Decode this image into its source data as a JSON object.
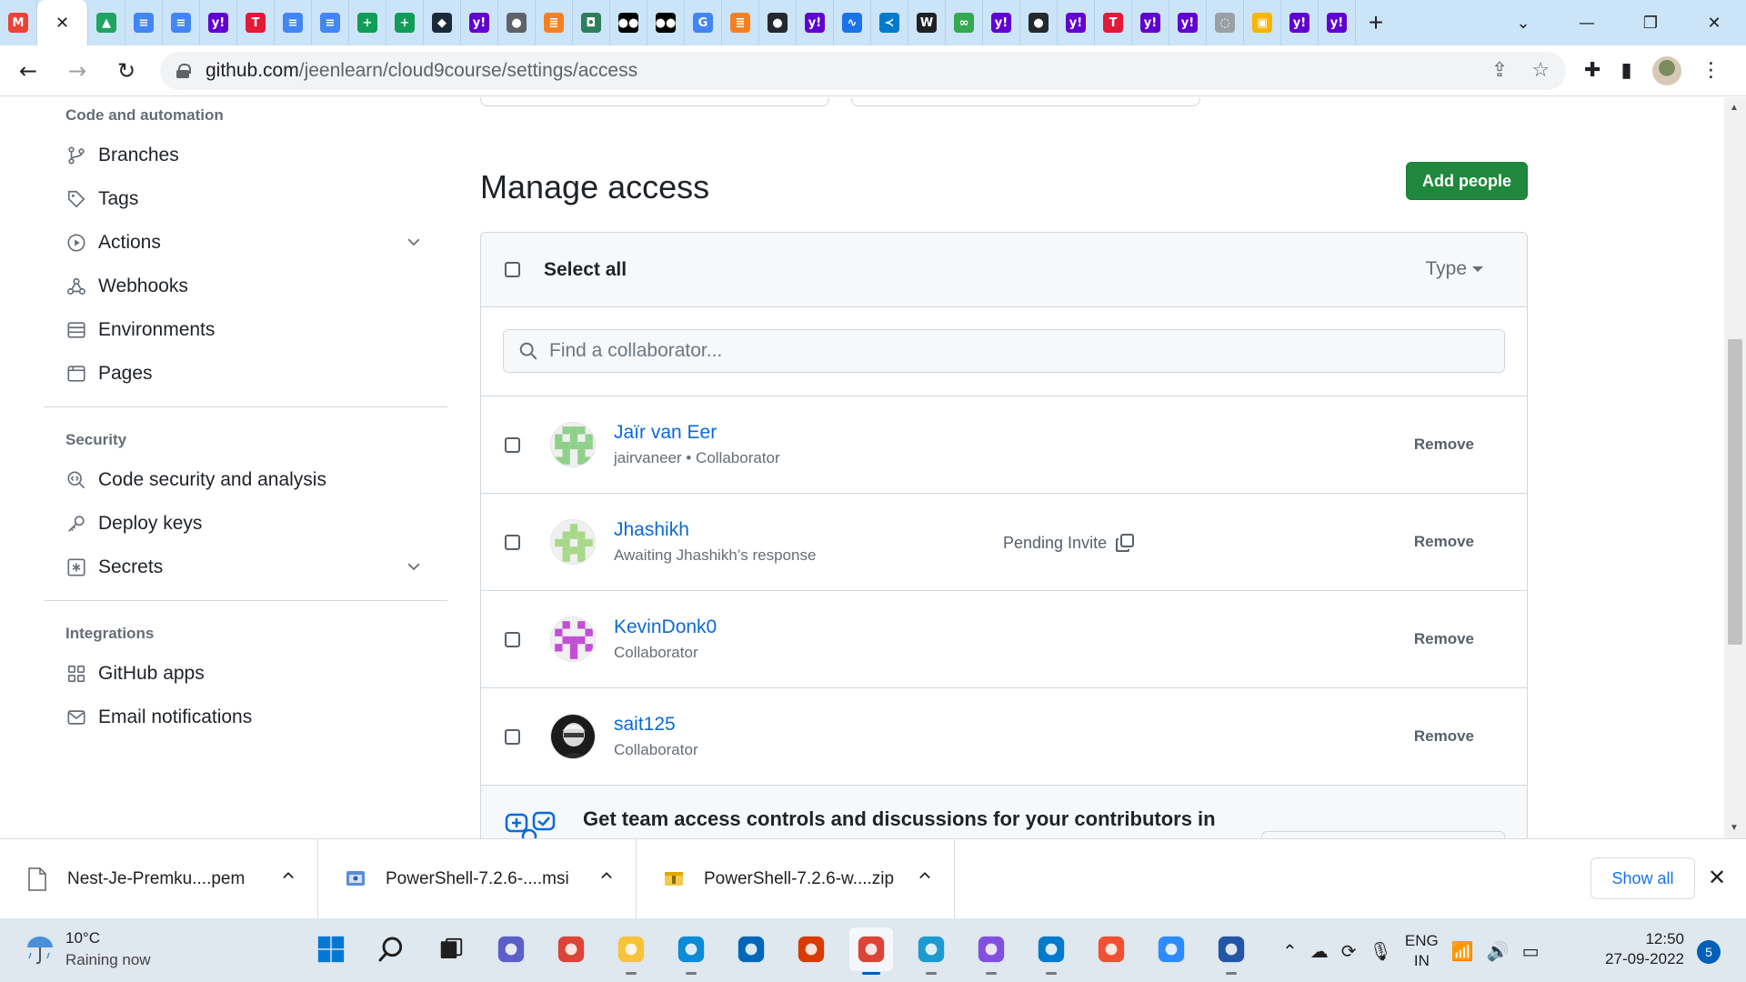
{
  "browser": {
    "tab_favicons": [
      {
        "icon": "gmail-icon",
        "label": "M",
        "color": "#ea4335"
      },
      {
        "icon": "close-tab-icon",
        "label": "✕",
        "color": "#202124"
      },
      {
        "icon": "google-drive-icon",
        "label": "▲",
        "color": "#1fa463"
      },
      {
        "icon": "google-docs-icon",
        "label": "≡",
        "color": "#4285f4"
      },
      {
        "icon": "google-docs-icon",
        "label": "≡",
        "color": "#4285f4"
      },
      {
        "icon": "yahoo-icon",
        "label": "y!",
        "color": "#6001d2"
      },
      {
        "icon": "tesla-icon",
        "label": "T",
        "color": "#e31937"
      },
      {
        "icon": "google-docs-icon",
        "label": "≡",
        "color": "#4285f4"
      },
      {
        "icon": "google-docs-icon",
        "label": "≡",
        "color": "#4285f4"
      },
      {
        "icon": "google-sheets-icon",
        "label": "+",
        "color": "#0f9d58"
      },
      {
        "icon": "google-sheets-icon",
        "label": "+",
        "color": "#0f9d58"
      },
      {
        "icon": "hex-icon",
        "label": "◆",
        "color": "#1b2a3a"
      },
      {
        "icon": "yahoo-icon",
        "label": "y!",
        "color": "#6001d2"
      },
      {
        "icon": "globe-icon",
        "label": "●",
        "color": "#5f6368"
      },
      {
        "icon": "stack-icon",
        "label": "≣",
        "color": "#f48024"
      },
      {
        "icon": "shield-icon",
        "label": "◘",
        "color": "#2e7d5b"
      },
      {
        "icon": "medium-icon",
        "label": "●●",
        "color": "#000000"
      },
      {
        "icon": "medium-icon",
        "label": "●●",
        "color": "#000000"
      },
      {
        "icon": "google-icon",
        "label": "G",
        "color": "#4285f4"
      },
      {
        "icon": "stack-icon",
        "label": "≣",
        "color": "#f48024"
      },
      {
        "icon": "github-icon",
        "label": "●",
        "color": "#24292f"
      },
      {
        "icon": "yahoo-icon",
        "label": "y!",
        "color": "#6001d2"
      },
      {
        "icon": "chart-icon",
        "label": "∿",
        "color": "#1a73e8"
      },
      {
        "icon": "vscode-icon",
        "label": "≺",
        "color": "#007acc"
      },
      {
        "icon": "wikipedia-icon",
        "label": "W",
        "color": "#202124"
      },
      {
        "icon": "infinity-icon",
        "label": "∞",
        "color": "#34a853"
      },
      {
        "icon": "yahoo-icon",
        "label": "y!",
        "color": "#6001d2"
      },
      {
        "icon": "github-icon",
        "label": "●",
        "color": "#24292f"
      },
      {
        "icon": "yahoo-icon",
        "label": "y!",
        "color": "#6001d2"
      },
      {
        "icon": "tesla-icon",
        "label": "T",
        "color": "#e31937"
      },
      {
        "icon": "yahoo-icon",
        "label": "y!",
        "color": "#6001d2"
      },
      {
        "icon": "yahoo-icon",
        "label": "y!",
        "color": "#6001d2"
      },
      {
        "icon": "loading-icon",
        "label": "◌",
        "color": "#9aa0a6"
      },
      {
        "icon": "python-icon",
        "label": "▣",
        "color": "#f7b500"
      },
      {
        "icon": "yahoo-icon",
        "label": "y!",
        "color": "#6001d2"
      },
      {
        "icon": "yahoo-icon",
        "label": "y!",
        "color": "#6001d2"
      }
    ],
    "url_host": "github.com",
    "url_path": "/jeenlearn/cloud9course/settings/access"
  },
  "sidebar": {
    "sections": [
      {
        "heading": "Code and automation",
        "items": [
          {
            "label": "Branches",
            "icon": "branch-icon",
            "expandable": false
          },
          {
            "label": "Tags",
            "icon": "tag-icon",
            "expandable": false
          },
          {
            "label": "Actions",
            "icon": "play-icon",
            "expandable": true
          },
          {
            "label": "Webhooks",
            "icon": "webhook-icon",
            "expandable": false
          },
          {
            "label": "Environments",
            "icon": "server-icon",
            "expandable": false
          },
          {
            "label": "Pages",
            "icon": "browser-icon",
            "expandable": false
          }
        ]
      },
      {
        "heading": "Security",
        "items": [
          {
            "label": "Code security and analysis",
            "icon": "codescan-icon",
            "expandable": false
          },
          {
            "label": "Deploy keys",
            "icon": "key-icon",
            "expandable": false
          },
          {
            "label": "Secrets",
            "icon": "asterisk-icon",
            "expandable": true
          }
        ]
      },
      {
        "heading": "Integrations",
        "items": [
          {
            "label": "GitHub apps",
            "icon": "apps-icon",
            "expandable": false
          },
          {
            "label": "Email notifications",
            "icon": "mail-icon",
            "expandable": false
          }
        ]
      }
    ]
  },
  "main": {
    "title": "Manage access",
    "add_people_label": "Add people",
    "select_all_label": "Select all",
    "type_filter_label": "Type",
    "search_placeholder": "Find a collaborator...",
    "collaborators": [
      {
        "name": "Jaïr van Eer",
        "subtitle": "jairvaneer • Collaborator",
        "avatar_color": "#8fd18a",
        "pending": false,
        "remove_label": "Remove"
      },
      {
        "name": "Jhashikh",
        "subtitle": "Awaiting Jhashikh’s response",
        "avatar_color": "#a8d98a",
        "pending": true,
        "pending_label": "Pending Invite",
        "remove_label": "Remove"
      },
      {
        "name": "KevinDonk0",
        "subtitle": "Collaborator",
        "avatar_color": "#c24fd6",
        "pending": false,
        "remove_label": "Remove"
      },
      {
        "name": "sait125",
        "subtitle": "Collaborator",
        "avatar_color": "#1b1b1b",
        "pending": false,
        "remove_label": "Remove"
      }
    ],
    "promo_text": "Get team access controls and discussions for your contributors in"
  },
  "downloads": {
    "items": [
      {
        "name": "Nest-Je-Premku....pem",
        "icon": "file-icon"
      },
      {
        "name": "PowerShell-7.2.6-....msi",
        "icon": "installer-icon"
      },
      {
        "name": "PowerShell-7.2.6-w....zip",
        "icon": "zip-icon"
      }
    ],
    "show_all_label": "Show all"
  },
  "taskbar": {
    "weather_temp": "10°C",
    "weather_desc": "Raining now",
    "apps": [
      {
        "name": "windows-start-icon",
        "color": "#0078d4",
        "running": false
      },
      {
        "name": "search-icon",
        "color": "#1f1f1f",
        "running": false
      },
      {
        "name": "task-view-icon",
        "color": "#1f1f1f",
        "running": false
      },
      {
        "name": "teams-chat-icon",
        "color": "#5b5fc7",
        "running": false
      },
      {
        "name": "chrome-icon",
        "color": "#db4437",
        "running": false
      },
      {
        "name": "file-explorer-icon",
        "color": "#f8c23a",
        "running": true
      },
      {
        "name": "edge-icon",
        "color": "#0c8bd6",
        "running": true
      },
      {
        "name": "store-icon",
        "color": "#0067b8",
        "running": false
      },
      {
        "name": "office-icon",
        "color": "#d83b01",
        "running": false
      },
      {
        "name": "chrome-profile-icon",
        "color": "#db4437",
        "running": true,
        "active": true
      },
      {
        "name": "slack-icon",
        "color": "#1d9bd1",
        "running": true
      },
      {
        "name": "github-desktop-icon",
        "color": "#8250df",
        "running": true
      },
      {
        "name": "vscode-icon",
        "color": "#007acc",
        "running": true
      },
      {
        "name": "git-icon",
        "color": "#f05133",
        "running": false
      },
      {
        "name": "zoom-icon",
        "color": "#2d8cff",
        "running": false
      },
      {
        "name": "network-app-icon",
        "color": "#2456a6",
        "running": true
      }
    ],
    "lang_top": "ENG",
    "lang_bottom": "IN",
    "time": "12:50",
    "date": "27-09-2022",
    "notification_count": "5"
  }
}
